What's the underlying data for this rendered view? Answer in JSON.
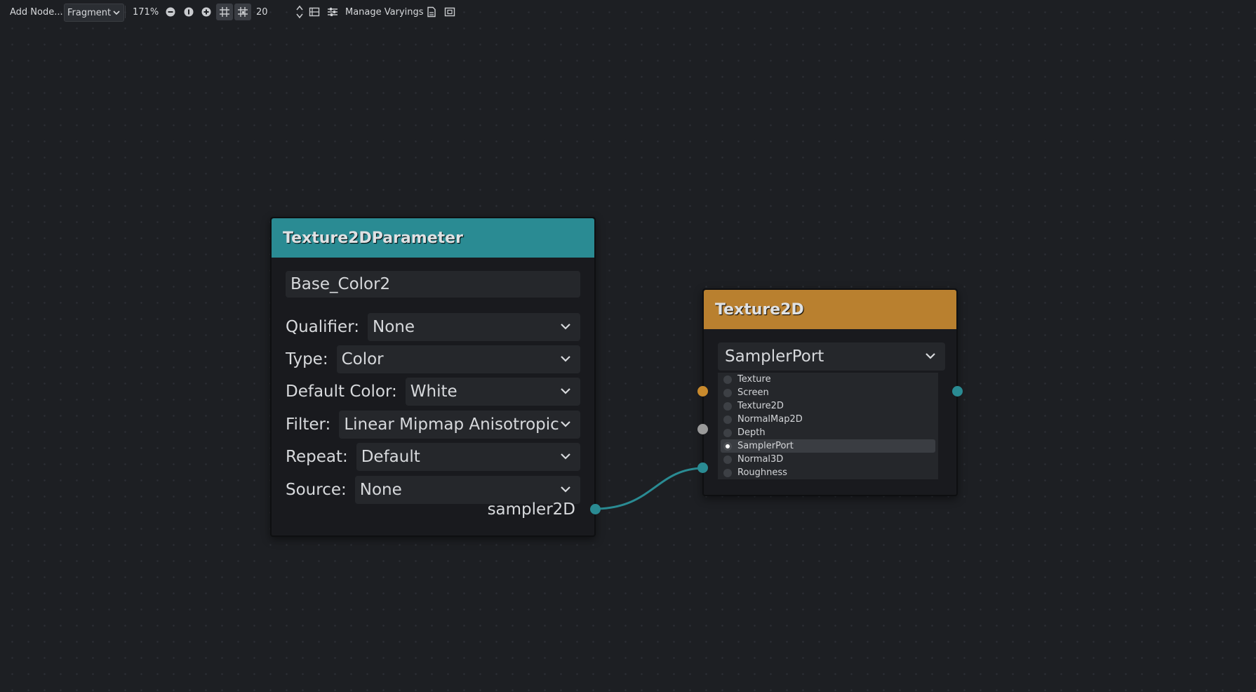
{
  "toolbar": {
    "add_node": "Add Node...",
    "shader_mode": "Fragment",
    "zoom": "171%",
    "snap_distance": "20",
    "manage_varyings": "Manage Varyings"
  },
  "param_node": {
    "title": "Texture2DParameter",
    "name_value": "Base_Color2",
    "rows": [
      {
        "label": "Qualifier:",
        "value": "None"
      },
      {
        "label": "Type:",
        "value": "Color"
      },
      {
        "label": "Default Color:",
        "value": "White"
      },
      {
        "label": "Filter:",
        "value": "Linear Mipmap Anisotropic"
      },
      {
        "label": "Repeat:",
        "value": "Default"
      },
      {
        "label": "Source:",
        "value": "None"
      }
    ],
    "output_label": "sampler2D"
  },
  "texture_node": {
    "title": "Texture2D",
    "source_value": "SamplerPort",
    "options": [
      "Texture",
      "Screen",
      "Texture2D",
      "NormalMap2D",
      "Depth",
      "SamplerPort",
      "Normal3D",
      "Roughness"
    ],
    "selected_option": "SamplerPort"
  },
  "colors": {
    "param_header": "#2a8b93",
    "texture_header": "#b9802f",
    "connection": "#2a8b93",
    "port_uv": "#c98a2d",
    "port_lod": "#9a9a9a",
    "port_sampler": "#2a8b93"
  }
}
